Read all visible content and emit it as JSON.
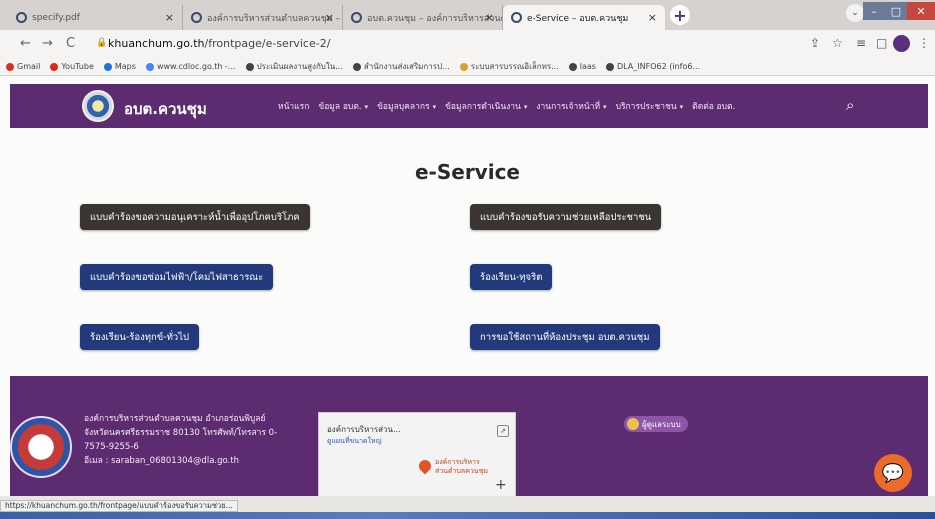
{
  "browser": {
    "tabs": [
      {
        "label": "specify.pdf",
        "active": false
      },
      {
        "label": "องค์การบริหารส่วนตำบลควนชุม – อบ...",
        "active": false
      },
      {
        "label": "อบต.ควนชุม – องค์การบริหารส่วนตำ...",
        "active": false
      },
      {
        "label": "e-Service – อบต.ควนชุม",
        "active": true
      }
    ],
    "tab_close_glyph": "×",
    "new_tab_glyph": "+",
    "profile_dropdown_glyph": "⌄",
    "window_buttons": {
      "minimize": "–",
      "maximize": "□",
      "close": "✕"
    },
    "nav": {
      "back": "←",
      "forward": "→",
      "reload": "C"
    },
    "url": {
      "host": "khuanchum.go.th",
      "path": "/frontpage/e-service-2/"
    },
    "toolbar_icons": {
      "share": "⇪",
      "bookmark": "☆",
      "media": "≡",
      "sidebar": "□",
      "menu": "⋮"
    },
    "bookmarks": [
      {
        "label": "Gmail",
        "icon": "gmail-icon",
        "color": "#d93025"
      },
      {
        "label": "YouTube",
        "icon": "youtube-icon",
        "color": "#e62117"
      },
      {
        "label": "Maps",
        "icon": "maps-icon",
        "color": "#1a73e8"
      },
      {
        "label": "www.cdloc.go.th -...",
        "icon": "google-icon",
        "color": "#4285f4"
      },
      {
        "label": "ประเมินผลงานสูงกับใน...",
        "icon": "globe-icon",
        "color": "#444444"
      },
      {
        "label": "สำนักงานส่งเสริมการป...",
        "icon": "globe-icon",
        "color": "#444444"
      },
      {
        "label": "ระบบสารบรรณอิเล็กทร...",
        "icon": "globe-icon",
        "color": "#d4a12a"
      },
      {
        "label": "laas",
        "icon": "globe-icon",
        "color": "#444444"
      },
      {
        "label": "DLA_INFO62 (info6...",
        "icon": "globe-icon",
        "color": "#444444"
      }
    ],
    "status_url": "https://khuanchum.go.th/frontpage/แบบคำร้องขอรับความช่วย..."
  },
  "site": {
    "name": "อบต.ควนชุม",
    "menu": [
      {
        "label": "หน้าแรก",
        "has_caret": false
      },
      {
        "label": "ข้อมูล อบต.",
        "has_caret": true
      },
      {
        "label": "ข้อมูลบุคลากร",
        "has_caret": true
      },
      {
        "label": "ข้อมูลการดำเนินงาน",
        "has_caret": true
      },
      {
        "label": "งานการเจ้าหน้าที่",
        "has_caret": true
      },
      {
        "label": "บริการประชาชน",
        "has_caret": true
      },
      {
        "label": "ติดต่อ อบต.",
        "has_caret": false
      }
    ],
    "caret_glyph": "▾",
    "search_glyph": "⌕",
    "colors": {
      "brand_purple": "#5d2b6f",
      "button_dark": "#3a3432",
      "button_navy": "#223a7b",
      "chat_orange": "#ec6b2a"
    }
  },
  "content": {
    "heading": "e-Service",
    "buttons": [
      {
        "label": "แบบคำร้องขอความอนุเคราะห์น้ำเพื่ออุปโภคบริโภค",
        "style": "dark"
      },
      {
        "label": "แบบคำร้องขอรับความช่วยเหลือประชาชน",
        "style": "dark"
      },
      {
        "label": "แบบคำร้องขอซ่อมไฟฟ้า/โคมไฟสาธารณะ",
        "style": "navy"
      },
      {
        "label": "ร้องเรียน-ทุจริต",
        "style": "navy"
      },
      {
        "label": "ร้องเรียน-ร้องทุกข์-ทั่วไป",
        "style": "navy"
      },
      {
        "label": "การขอใช้สถานที่ห้องประชุม อบต.ควนชุม",
        "style": "navy"
      }
    ]
  },
  "footer": {
    "address_lines": [
      "องค์การบริหารส่วนตำบลควนชุม อำเภอร่อนพิบูลย์",
      "จังหวัดนครศรีธรรมราช 80130 โทรศัพท์/โทรสาร 0-",
      "7575-9255-6",
      "อีเมล : saraban_06801304@dla.go.th"
    ],
    "map": {
      "place_name": "องค์การบริหารส่วน...",
      "link": "ดูแผนที่ขนาดใหญ่",
      "directions_glyph": "⇗",
      "pin_label_1": "องค์การบริหาร",
      "pin_label_2": "ส่วนตำบลควนชุม",
      "zoom_in_glyph": "+"
    },
    "visitor_counter_label": "ผู้ดูแลระบบ",
    "chat_glyph": "💬"
  }
}
